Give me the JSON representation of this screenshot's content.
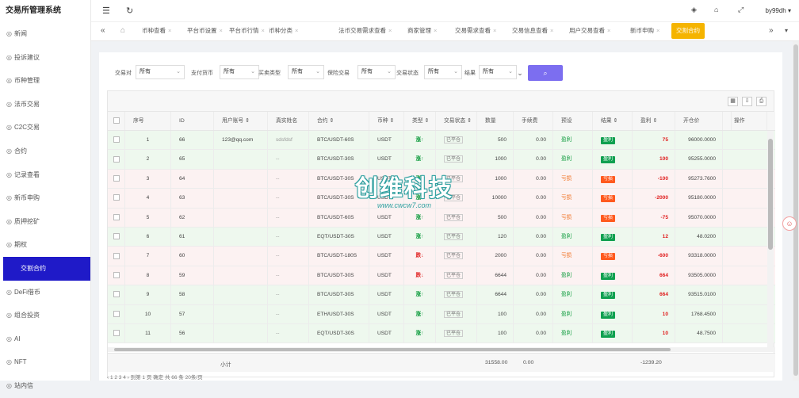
{
  "app": {
    "title": "交易所管理系统",
    "user": "by99dh"
  },
  "sidebar": {
    "items": [
      {
        "label": "新闻",
        "icon": "gear-icon"
      },
      {
        "label": "投诉建议",
        "icon": "gear-icon"
      },
      {
        "label": "币种管理",
        "icon": "gear-icon"
      },
      {
        "label": "法币交易",
        "icon": "gear-icon"
      },
      {
        "label": "C2C交易",
        "icon": "gear-icon"
      },
      {
        "label": "合约",
        "icon": "gear-icon"
      },
      {
        "label": "记录查看",
        "icon": "gear-icon"
      },
      {
        "label": "新币申购",
        "icon": "gear-icon"
      },
      {
        "label": "质押挖矿",
        "icon": "gear-icon"
      },
      {
        "label": "期权",
        "icon": "gear-icon"
      },
      {
        "label": "交割合约",
        "icon": "none"
      },
      {
        "label": "DeFi借币",
        "icon": "gear-icon"
      },
      {
        "label": "组合投资",
        "icon": "gear-icon"
      },
      {
        "label": "AI",
        "icon": "gear-icon"
      },
      {
        "label": "NFT",
        "icon": "gear-icon"
      },
      {
        "label": "站内信",
        "icon": "gear-icon"
      }
    ]
  },
  "tabs": [
    {
      "label": "币种查看"
    },
    {
      "label": "平台币设置"
    },
    {
      "label": "平台币行情"
    },
    {
      "label": "币种分类"
    },
    {
      "label": "法币交易需求查看"
    },
    {
      "label": "商家管理"
    },
    {
      "label": "交易需求查看"
    },
    {
      "label": "交易信息查看"
    },
    {
      "label": "用户交易查看"
    },
    {
      "label": "新币申购"
    },
    {
      "label": "交割合约"
    }
  ],
  "filters": [
    {
      "label": "交易对",
      "value": "所有"
    },
    {
      "label": "支付货币",
      "value": "所有"
    },
    {
      "label": "买卖类型",
      "value": "所有"
    },
    {
      "label": "保险交易",
      "value": "所有"
    },
    {
      "label": "交易状态",
      "value": "所有"
    },
    {
      "label": "结果",
      "value": "所有"
    }
  ],
  "table": {
    "headers": [
      "",
      "序号",
      "ID",
      "用户账号 ⇕",
      "真实姓名",
      "合约 ⇕",
      "币种 ⇕",
      "类型 ⇕",
      "交易状态 ⇕",
      "数量",
      "手续费",
      "预设",
      "结果 ⇕",
      "盈利 ⇕",
      "开仓价",
      "",
      "操作"
    ],
    "rows": [
      [
        "1",
        "66",
        "123@qq.com",
        "sdsfdsf",
        "BTC/USDT-60S",
        "USDT",
        "涨↑",
        "已平仓",
        "500",
        "0.00",
        "盈利",
        "盈利",
        "75",
        "96000.0000"
      ],
      [
        "2",
        "65",
        "",
        "--",
        "BTC/USDT-30S",
        "USDT",
        "涨↑",
        "已平仓",
        "1000",
        "0.00",
        "盈利",
        "盈利",
        "100",
        "95255.0000"
      ],
      [
        "3",
        "64",
        "",
        "--",
        "BTC/USDT-30S",
        "USDT",
        "涨↑",
        "已平仓",
        "1000",
        "0.00",
        "亏损",
        "亏损",
        "-100",
        "95273.7600"
      ],
      [
        "4",
        "63",
        "",
        "--",
        "BTC/USDT-30S",
        "USDT",
        "涨↑",
        "已平仓",
        "10000",
        "0.00",
        "亏损",
        "亏损",
        "-2000",
        "95180.0000"
      ],
      [
        "5",
        "62",
        "",
        "--",
        "BTC/USDT-60S",
        "USDT",
        "涨↑",
        "已平仓",
        "500",
        "0.00",
        "亏损",
        "亏损",
        "-75",
        "95070.0000"
      ],
      [
        "6",
        "61",
        "",
        "--",
        "EQT/USDT-30S",
        "USDT",
        "涨↑",
        "已平仓",
        "120",
        "0.00",
        "盈利",
        "盈利",
        "12",
        "48.0200"
      ],
      [
        "7",
        "60",
        "",
        "--",
        "BTC/USDT-180S",
        "USDT",
        "跌↓",
        "已平仓",
        "2000",
        "0.00",
        "亏损",
        "亏损",
        "-600",
        "93318.0000"
      ],
      [
        "8",
        "59",
        "",
        "--",
        "BTC/USDT-30S",
        "USDT",
        "跌↓",
        "已平仓",
        "6644",
        "0.00",
        "盈利",
        "盈利",
        "664",
        "93505.0000"
      ],
      [
        "9",
        "58",
        "",
        "--",
        "BTC/USDT-30S",
        "USDT",
        "涨↑",
        "已平仓",
        "6644",
        "0.00",
        "盈利",
        "盈利",
        "664",
        "93515.0100"
      ],
      [
        "10",
        "57",
        "",
        "--",
        "ETH/USDT-30S",
        "USDT",
        "涨↑",
        "已平仓",
        "100",
        "0.00",
        "盈利",
        "盈利",
        "10",
        "1768.4500"
      ],
      [
        "11",
        "56",
        "",
        "--",
        "EQT/USDT-30S",
        "USDT",
        "涨↑",
        "已平仓",
        "100",
        "0.00",
        "盈利",
        "盈利",
        "10",
        "48.7500"
      ]
    ],
    "summary": {
      "label": "小计",
      "qty": "31558.00",
      "fee": "0.00",
      "profit": "-1239.20"
    }
  },
  "watermark": {
    "big": "创维科技",
    "small": "www.cwcw7.com"
  },
  "pager": {
    "text": "‹  1  2  3  4  ›  到第  1  页  确定  共 66 条  20条/页"
  },
  "colors": {
    "accent": "#1f1ac8",
    "active_tab": "#f5b400",
    "search_btn": "#7c6ef0",
    "up_row": "#eef8ee",
    "down_row": "#fcf2f2"
  }
}
